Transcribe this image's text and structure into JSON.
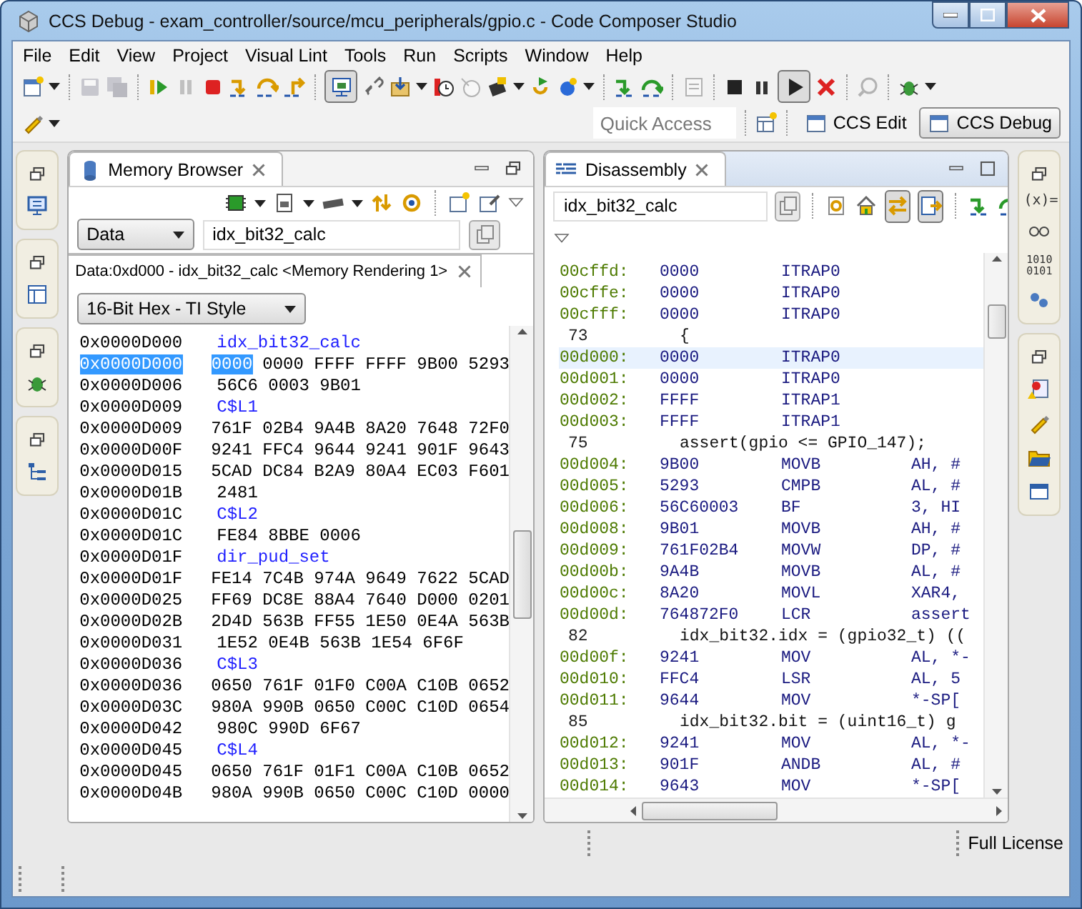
{
  "window": {
    "title": "CCS Debug - exam_controller/source/mcu_peripherals/gpio.c - Code Composer Studio"
  },
  "menu": [
    "File",
    "Edit",
    "View",
    "Project",
    "Visual Lint",
    "Tools",
    "Run",
    "Scripts",
    "Window",
    "Help"
  ],
  "quick_access": {
    "placeholder": "Quick Access"
  },
  "perspectives": [
    {
      "label": "CCS Edit",
      "selected": false
    },
    {
      "label": "CCS Debug",
      "selected": true
    }
  ],
  "memory_browser": {
    "title": "Memory Browser",
    "active": false,
    "space": "Data",
    "expression": "idx_bit32_calc",
    "rendering_tab": "Data:0xd000 - idx_bit32_calc <Memory Rendering 1>",
    "format": "16-Bit Hex - TI Style",
    "rows": [
      {
        "kind": "label",
        "address": "0x0000D000",
        "text": "idx_bit32_calc",
        "selected": false
      },
      {
        "kind": "data",
        "address": "0x0000D000",
        "cursor": "0000",
        "text": "0000 FFFF FFFF 9B00 5293",
        "selected": true
      },
      {
        "kind": "data",
        "address": "0x0000D006",
        "text": "56C6 0003 9B01",
        "selected": false
      },
      {
        "kind": "label",
        "address": "0x0000D009",
        "text": "C$L1",
        "selected": false
      },
      {
        "kind": "data",
        "address": "0x0000D009",
        "text": "761F 02B4 9A4B 8A20 7648 72F0",
        "selected": false
      },
      {
        "kind": "data",
        "address": "0x0000D00F",
        "text": "9241 FFC4 9644 9241 901F 9643",
        "selected": false
      },
      {
        "kind": "data",
        "address": "0x0000D015",
        "text": "5CAD DC84 B2A9 80A4 EC03 F601",
        "selected": false
      },
      {
        "kind": "data",
        "address": "0x0000D01B",
        "text": "2481",
        "selected": false
      },
      {
        "kind": "label",
        "address": "0x0000D01C",
        "text": "C$L2",
        "selected": false
      },
      {
        "kind": "data",
        "address": "0x0000D01C",
        "text": "FE84 8BBE 0006",
        "selected": false
      },
      {
        "kind": "label",
        "address": "0x0000D01F",
        "text": "dir_pud_set",
        "selected": false
      },
      {
        "kind": "data",
        "address": "0x0000D01F",
        "text": "FE14 7C4B 974A 9649 7622 5CAD",
        "selected": false
      },
      {
        "kind": "data",
        "address": "0x0000D025",
        "text": "FF69 DC8E 88A4 7640 D000 0201",
        "selected": false
      },
      {
        "kind": "data",
        "address": "0x0000D02B",
        "text": "2D4D 563B FF55 1E50 0E4A 563B",
        "selected": false
      },
      {
        "kind": "data",
        "address": "0x0000D031",
        "text": "1E52 0E4B 563B 1E54 6F6F",
        "selected": false
      },
      {
        "kind": "label",
        "address": "0x0000D036",
        "text": "C$L3",
        "selected": false
      },
      {
        "kind": "data",
        "address": "0x0000D036",
        "text": "0650 761F 01F0 C00A C10B 0652",
        "selected": false
      },
      {
        "kind": "data",
        "address": "0x0000D03C",
        "text": "980A 990B 0650 C00C C10D 0654",
        "selected": false
      },
      {
        "kind": "data",
        "address": "0x0000D042",
        "text": "980C 990D 6F67",
        "selected": false
      },
      {
        "kind": "label",
        "address": "0x0000D045",
        "text": "C$L4",
        "selected": false
      },
      {
        "kind": "data",
        "address": "0x0000D045",
        "text": "0650 761F 01F1 C00A C10B 0652",
        "selected": false
      },
      {
        "kind": "data",
        "address": "0x0000D04B",
        "text": "980A 990B 0650 C00C C10D 0000",
        "selected": false
      }
    ]
  },
  "disassembly": {
    "title": "Disassembly",
    "active": true,
    "expression": "idx_bit32_calc",
    "rows": [
      {
        "kind": "instr",
        "address": "00cffd:",
        "opcode": "0000",
        "mnemonic": "ITRAP0",
        "selected": false
      },
      {
        "kind": "instr",
        "address": "00cffe:",
        "opcode": "0000",
        "mnemonic": "ITRAP0",
        "selected": false
      },
      {
        "kind": "instr",
        "address": "00cfff:",
        "opcode": "0000",
        "mnemonic": "ITRAP0",
        "selected": false
      },
      {
        "kind": "source",
        "line": "73",
        "code": "{",
        "selected": false
      },
      {
        "kind": "instr",
        "address": "00d000:",
        "opcode": "0000",
        "mnemonic": "ITRAP0",
        "selected": true
      },
      {
        "kind": "instr",
        "address": "00d001:",
        "opcode": "0000",
        "mnemonic": "ITRAP0",
        "selected": false
      },
      {
        "kind": "instr",
        "address": "00d002:",
        "opcode": "FFFF",
        "mnemonic": "ITRAP1",
        "selected": false
      },
      {
        "kind": "instr",
        "address": "00d003:",
        "opcode": "FFFF",
        "mnemonic": "ITRAP1",
        "selected": false
      },
      {
        "kind": "source",
        "line": "75",
        "code": "assert(gpio <= GPIO_147);",
        "selected": false
      },
      {
        "kind": "instr",
        "address": "00d004:",
        "opcode": "9B00",
        "mnemonic": "MOVB",
        "operands": "AH, #",
        "selected": false
      },
      {
        "kind": "instr",
        "address": "00d005:",
        "opcode": "5293",
        "mnemonic": "CMPB",
        "operands": "AL, #",
        "selected": false
      },
      {
        "kind": "instr",
        "address": "00d006:",
        "opcode": "56C60003",
        "mnemonic": "BF",
        "operands": "3, HI",
        "selected": false
      },
      {
        "kind": "instr",
        "address": "00d008:",
        "opcode": "9B01",
        "mnemonic": "MOVB",
        "operands": "AH, #",
        "selected": false
      },
      {
        "kind": "instr",
        "address": "00d009:",
        "opcode": "761F02B4",
        "mnemonic": "MOVW",
        "operands": "DP, #",
        "selected": false
      },
      {
        "kind": "instr",
        "address": "00d00b:",
        "opcode": "9A4B",
        "mnemonic": "MOVB",
        "operands": "AL, #",
        "selected": false
      },
      {
        "kind": "instr",
        "address": "00d00c:",
        "opcode": "8A20",
        "mnemonic": "MOVL",
        "operands": "XAR4,",
        "selected": false
      },
      {
        "kind": "instr",
        "address": "00d00d:",
        "opcode": "764872F0",
        "mnemonic": "LCR",
        "operands": "assert",
        "selected": false
      },
      {
        "kind": "source",
        "line": "82",
        "code": "idx_bit32.idx = (gpio32_t) ((",
        "selected": false
      },
      {
        "kind": "instr",
        "address": "00d00f:",
        "opcode": "9241",
        "mnemonic": "MOV",
        "operands": "AL, *-",
        "selected": false
      },
      {
        "kind": "instr",
        "address": "00d010:",
        "opcode": "FFC4",
        "mnemonic": "LSR",
        "operands": "AL, 5",
        "selected": false
      },
      {
        "kind": "instr",
        "address": "00d011:",
        "opcode": "9644",
        "mnemonic": "MOV",
        "operands": "*-SP[",
        "selected": false
      },
      {
        "kind": "source",
        "line": "85",
        "code": "idx_bit32.bit = (uint16_t) g",
        "selected": false
      },
      {
        "kind": "instr",
        "address": "00d012:",
        "opcode": "9241",
        "mnemonic": "MOV",
        "operands": "AL, *-",
        "selected": false
      },
      {
        "kind": "instr",
        "address": "00d013:",
        "opcode": "901F",
        "mnemonic": "ANDB",
        "operands": "AL, #",
        "selected": false
      },
      {
        "kind": "instr",
        "address": "00d014:",
        "opcode": "9643",
        "mnemonic": "MOV",
        "operands": "*-SP[",
        "selected": false
      }
    ]
  },
  "right_trim": {
    "variables_label": "(x)=",
    "registers_label": "1010 0101"
  },
  "status_bar": {
    "license": "Full License"
  }
}
